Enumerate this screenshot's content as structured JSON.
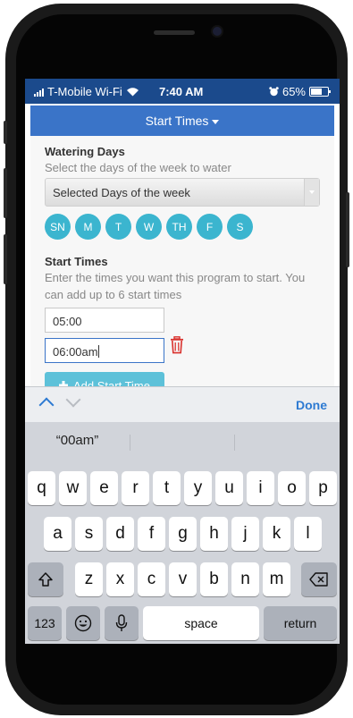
{
  "status_bar": {
    "carrier": "T-Mobile Wi-Fi",
    "time": "7:40 AM",
    "battery_percent": "65%",
    "battery_level": 0.65
  },
  "header": {
    "title": "Start Times"
  },
  "watering_days": {
    "title": "Watering Days",
    "description": "Select the days of the week to water",
    "select_value": "Selected Days of the week",
    "days": [
      "SN",
      "M",
      "T",
      "W",
      "TH",
      "F",
      "S"
    ]
  },
  "start_times": {
    "title": "Start Times",
    "description_line1": "Enter the times you want this program to start. You",
    "description_line2": "can add up to 6 start times",
    "times": [
      "05:00",
      "06:00am"
    ],
    "add_button_label": "Add Start Time"
  },
  "accessory_bar": {
    "done_label": "Done"
  },
  "keyboard": {
    "prediction": "“00am”",
    "row1": [
      "q",
      "w",
      "e",
      "r",
      "t",
      "y",
      "u",
      "i",
      "o",
      "p"
    ],
    "row2": [
      "a",
      "s",
      "d",
      "f",
      "g",
      "h",
      "j",
      "k",
      "l"
    ],
    "row3": [
      "z",
      "x",
      "c",
      "v",
      "b",
      "n",
      "m"
    ],
    "numbers_label": "123",
    "space_label": "space",
    "return_label": "return"
  },
  "colors": {
    "status_bar": "#1b4a8c",
    "header": "#3a74c8",
    "day_chip": "#3bb5cf",
    "add_button": "#5dc1d9",
    "delete_icon": "#d9302c",
    "done": "#2d7ad2"
  }
}
